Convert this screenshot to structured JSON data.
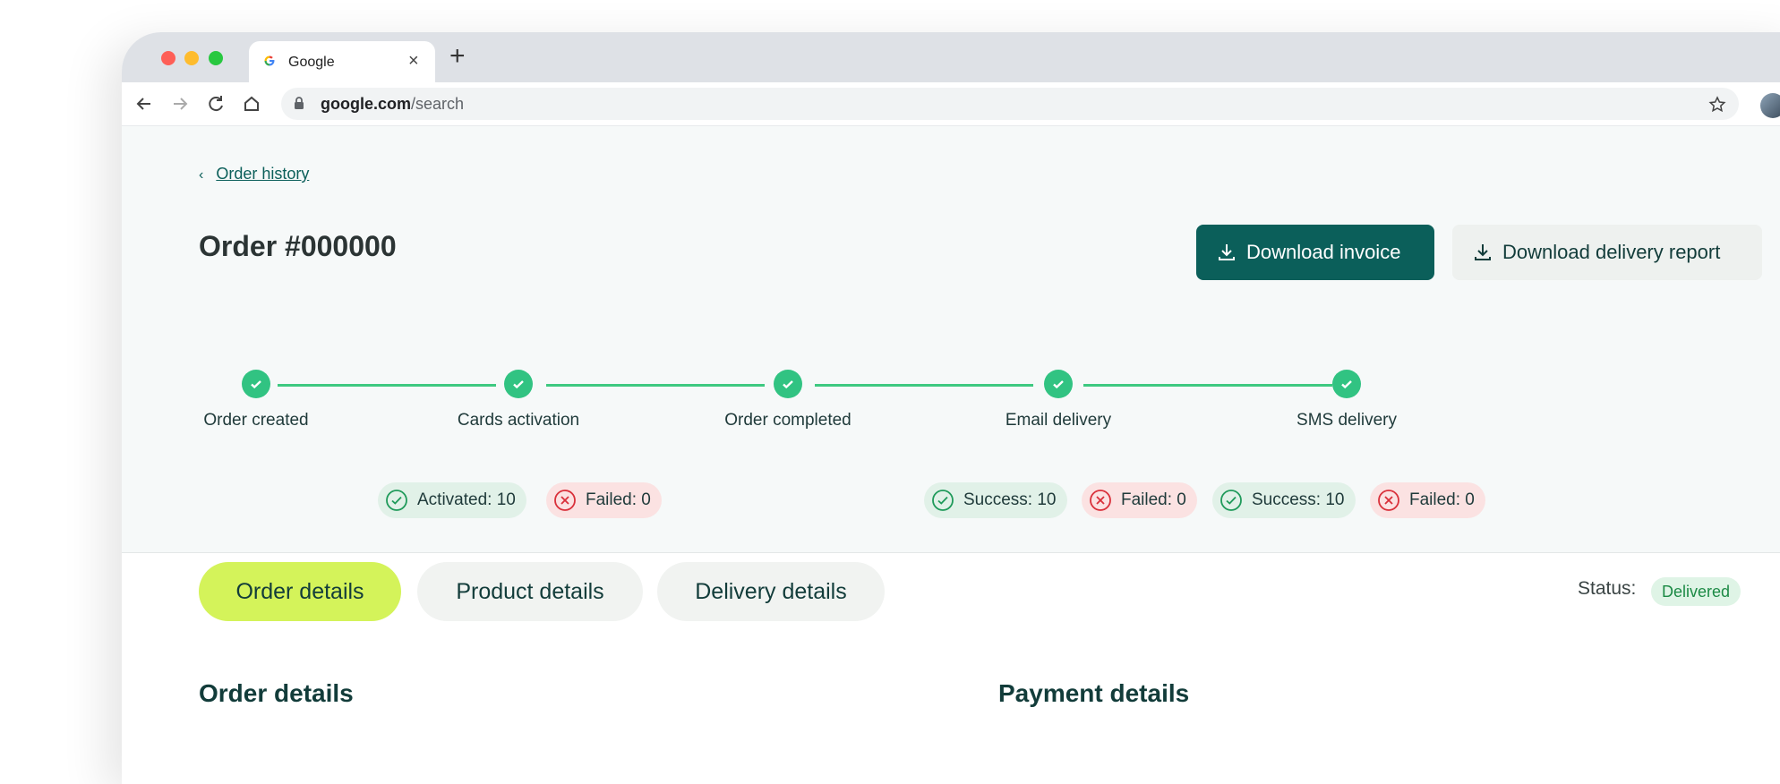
{
  "browser": {
    "tab_title": "Google",
    "tab_close": "×",
    "new_tab": "+",
    "url_domain": "google.com",
    "url_path": "/search"
  },
  "breadcrumb": {
    "label": "Order history"
  },
  "order": {
    "title": "Order #000000"
  },
  "actions": {
    "download_invoice": "Download invoice",
    "download_delivery_report": "Download delivery report"
  },
  "steps": [
    {
      "label": "Order created"
    },
    {
      "label": "Cards activation"
    },
    {
      "label": "Order completed"
    },
    {
      "label": "Email delivery"
    },
    {
      "label": "SMS delivery"
    }
  ],
  "stats": {
    "activation_ok": "Activated: 10",
    "activation_fail": "Failed: 0",
    "email_ok": "Success: 10",
    "email_fail": "Failed: 0",
    "sms_ok": "Success: 10",
    "sms_fail": "Failed: 0"
  },
  "tabs": [
    {
      "label": "Order details",
      "active": true
    },
    {
      "label": "Product details",
      "active": false
    },
    {
      "label": "Delivery details",
      "active": false
    }
  ],
  "status": {
    "label": "Status:",
    "value": "Delivered"
  },
  "sections": {
    "order_details": "Order details",
    "payment_details": "Payment details"
  },
  "colors": {
    "primary": "#0b5f5a",
    "accent": "#d4f35a",
    "success": "#31c382",
    "failure": "#d9303a"
  }
}
